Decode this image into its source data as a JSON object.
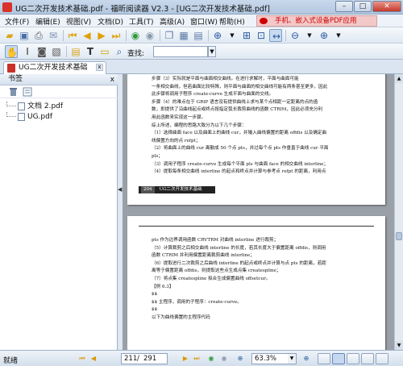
{
  "window": {
    "title": "UG二次开发技术基础.pdf - 福昕阅读器 V2.3 - [UG二次开发技术基础.pdf]",
    "minimize": "–",
    "maximize": "□",
    "close": "✕"
  },
  "menu": {
    "items": [
      "文件(F)",
      "编辑(E)",
      "视图(V)",
      "文档(D)",
      "工具(T)",
      "高级(A)",
      "窗口(W)",
      "帮助(H)"
    ],
    "ad_text": "手机、嵌入式设备PDF应用"
  },
  "toolbar": {
    "find_label": "查找:",
    "find_value": ""
  },
  "tab": {
    "label": "UG二次开发技术基础",
    "close": "x"
  },
  "sidebar": {
    "title": "书签",
    "close": "x",
    "items": [
      "文档 2.pdf",
      "UG.pdf"
    ]
  },
  "page1": {
    "lines": [
      "步骤（3）实际就是平面与曲面相交曲线。在进行求解时，平面与曲面可能",
      "一条相交曲线，但若曲面比较特殊，则平面与曲面的相交曲线可能有两条甚至更多，因此",
      "此步骤将调用子程序 create-curve 生成平面与曲面的交线。",
      "步骤（4）的难点在于 GRIP 语言没有提供曲线上求与某个点相距一定距离的点的函",
      "数，即提供了沿曲线起点或终点按指定弧长裁剪曲线的函数 CTRIM，因此必须充分利",
      "用此函数来实现这一步骤。",
      "综上所述，编程的思路大致分为以下几个步骤：",
      "（1）选择曲面 face 以及曲面上的曲线 cur，并输入曲线偏置的距离 offdis 以及确定曲",
      "线偏置方向的点 refpt；",
      "（2）将曲面上的曲线 cur 离散成 50 个点 pts，并过每个点 pts 作垂直于曲线 cur 平面",
      "pls；",
      "（3）调用子程序 create-curve 生成每个平面 pls 与曲面 face 的相交曲线 interline；",
      "（4）提取每条相交曲线 interline 的起点和终点并计算与参考点 refpt 的距离，利用点"
    ],
    "footer_num": "204",
    "footer_title": "UG二次开发技术基础"
  },
  "page2": {
    "lines": [
      "pts 作为边界调用函数 CRVTRM 对曲线 interline 进行裁剪；",
      "（5）计算裁剪之后相交曲线 interline 的长度，若其长度大于偏置距离 offdis，则调用",
      "函数 CTRIM 并利用偏置距离裁剪曲线 interline；",
      "（6）提取进行二次裁剪之后曲线 interline 的起点或终点并计算与点 pts 的距离，若距",
      "离等于偏置距离 offdis，则提取这些点生成点集 createspline；",
      "（7）将点集 createspline 拟合生成偏置曲线 offsetcur。",
      "【例 6.3】",
      "$$",
      "$$      主程序，调用的子程序：create-curve。",
      "$$",
      "",
      "以下为曲线偏置的主程序代码"
    ]
  },
  "status": {
    "text": "就绪",
    "current_page": "211",
    "slash": "/",
    "total_pages": "291",
    "zoom": "63.3%"
  }
}
